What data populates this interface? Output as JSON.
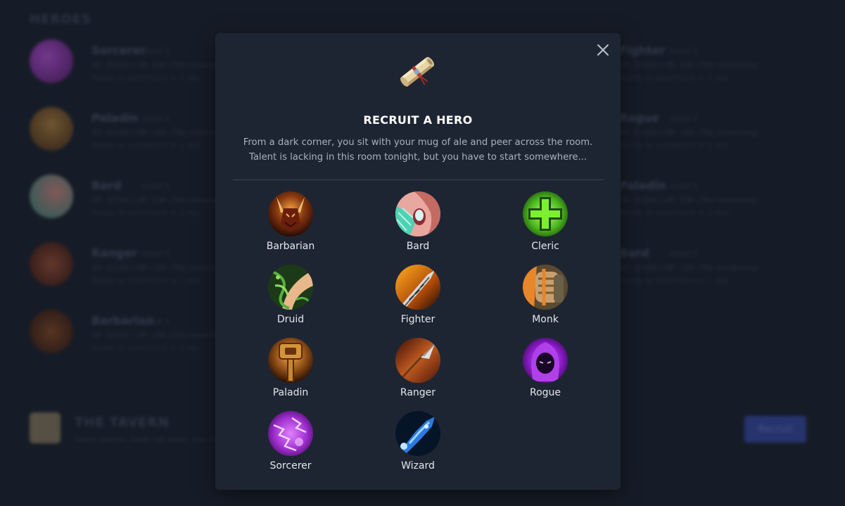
{
  "background": {
    "section_title": "HEROES",
    "heroes_left": [
      {
        "name": "Sorcerer",
        "level": "Level 1",
        "stats": "XP: 0/100 | HP: 100 (70s remaining)",
        "status": "Ready to adventure in 1 day",
        "color": "#8c2fb0"
      },
      {
        "name": "Paladin",
        "level": "Level 1",
        "stats": "XP: 0/100 | HP: 100 (70s remaining)",
        "status": "Ready to adventure in 1 day",
        "color": "#8a5a1c"
      },
      {
        "name": "Bard",
        "level": "Level 1",
        "stats": "XP: 0/100 | HP: 100 (70s remaining)",
        "status": "Ready to adventure in 1 day",
        "color": "#3fa898"
      },
      {
        "name": "Ranger",
        "level": "Level 1",
        "stats": "XP: 0/100 | HP: 100 (70s remaining)",
        "status": "Ready to adventure in 1 day",
        "color": "#6b2418"
      },
      {
        "name": "Barbarian",
        "level": "Level 1",
        "stats": "XP: 0/100 | HP: 100 (70s remaining)",
        "status": "Ready to adventure in 1 day",
        "color": "#5a2a14"
      }
    ],
    "heroes_right": [
      {
        "name": "Fighter",
        "level": "Level 1",
        "stats": "XP: 0/100 | HP: 100 (70s remaining)",
        "status": "Ready to adventure in 1 day"
      },
      {
        "name": "Rogue",
        "level": "Level 1",
        "stats": "XP: 0/100 | HP: 100 (70s remaining)",
        "status": "Ready to adventure in 1 day"
      },
      {
        "name": "Paladin",
        "level": "Level 1",
        "stats": "XP: 0/100 | HP: 100 (70s remaining)",
        "status": "Ready to adventure in 1 day"
      },
      {
        "name": "Bard",
        "level": "Level 1",
        "stats": "XP: 0/100 | HP: 100 (70s remaining)",
        "status": "Ready to adventure in 1 day"
      }
    ],
    "tavern": {
      "title": "THE TAVERN",
      "subtitle": "Share stories, trade tall tales, and recruit heroes"
    },
    "recruit_button": "Recruit"
  },
  "modal": {
    "title": "RECRUIT A HERO",
    "description_line1": "From a dark corner, you sit with your mug of ale and peer across the room.",
    "description_line2": "Talent is lacking in this room tonight, but you have to start somewhere...",
    "header_icon": "scroll-icon",
    "close_icon": "close-icon",
    "classes": [
      {
        "label": "Barbarian",
        "icon": "barbarian-icon"
      },
      {
        "label": "Bard",
        "icon": "bard-icon"
      },
      {
        "label": "Cleric",
        "icon": "cleric-icon"
      },
      {
        "label": "Druid",
        "icon": "druid-icon"
      },
      {
        "label": "Fighter",
        "icon": "fighter-icon"
      },
      {
        "label": "Monk",
        "icon": "monk-icon"
      },
      {
        "label": "Paladin",
        "icon": "paladin-icon"
      },
      {
        "label": "Ranger",
        "icon": "ranger-icon"
      },
      {
        "label": "Rogue",
        "icon": "rogue-icon"
      },
      {
        "label": "Sorcerer",
        "icon": "sorcerer-icon"
      },
      {
        "label": "Wizard",
        "icon": "wizard-icon"
      }
    ]
  },
  "colors": {
    "page_bg": "#161c27",
    "modal_bg": "#1e2532",
    "title": "#ffffff",
    "description": "#a8b0be",
    "button_accent": "#3447a6"
  }
}
